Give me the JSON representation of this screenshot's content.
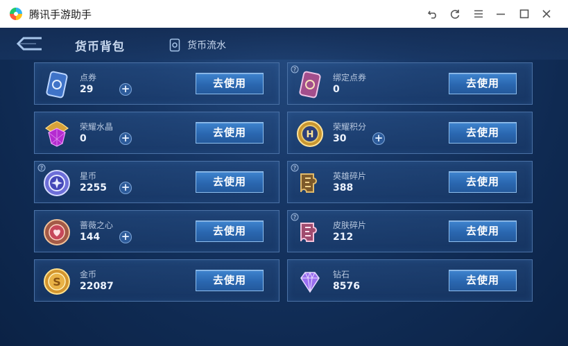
{
  "window": {
    "title": "腾讯手游助手",
    "controls": [
      "undo-icon",
      "refresh-icon",
      "menu-icon",
      "minimize-icon",
      "maximize-icon",
      "close-icon"
    ]
  },
  "header": {
    "tabs": [
      {
        "label": "货币背包",
        "active": true
      },
      {
        "label": "货币流水",
        "active": false
      }
    ]
  },
  "colors": {
    "background": "#173766",
    "card_border": "#4b72a6",
    "button": "#2a67b0",
    "title_bar": "#ffffff"
  },
  "currencies": [
    {
      "name": "点券",
      "amount": "29",
      "has_plus": true,
      "icon": "voucher-card-icon",
      "button": "去使用"
    },
    {
      "name": "绑定点券",
      "amount": "0",
      "has_plus": false,
      "icon": "bound-voucher-card-icon",
      "button": "去使用"
    },
    {
      "name": "荣耀水晶",
      "amount": "0",
      "has_plus": true,
      "icon": "glory-crystal-icon",
      "button": "去使用"
    },
    {
      "name": "荣耀积分",
      "amount": "30",
      "has_plus": true,
      "icon": "glory-points-icon",
      "button": "去使用"
    },
    {
      "name": "星币",
      "amount": "2255",
      "has_plus": true,
      "icon": "star-coin-icon",
      "button": "去使用"
    },
    {
      "name": "英雄碎片",
      "amount": "388",
      "has_plus": false,
      "icon": "hero-fragment-icon",
      "button": "去使用"
    },
    {
      "name": "蔷薇之心",
      "amount": "144",
      "has_plus": true,
      "icon": "rose-heart-icon",
      "button": "去使用"
    },
    {
      "name": "皮肤碎片",
      "amount": "212",
      "has_plus": false,
      "icon": "skin-fragment-icon",
      "button": "去使用"
    },
    {
      "name": "金币",
      "amount": "22087",
      "has_plus": false,
      "icon": "gold-coin-icon",
      "button": "去使用"
    },
    {
      "name": "钻石",
      "amount": "8576",
      "has_plus": false,
      "icon": "diamond-icon",
      "button": "去使用"
    }
  ]
}
